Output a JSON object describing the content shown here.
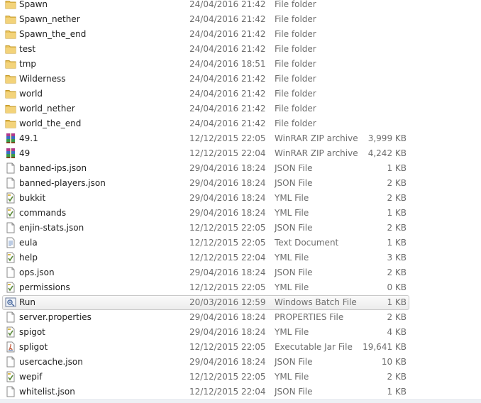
{
  "files": [
    {
      "name": "Spawn",
      "date": "24/04/2016 21:42",
      "type": "File folder",
      "size": "",
      "icon": "folder-icon"
    },
    {
      "name": "Spawn_nether",
      "date": "24/04/2016 21:42",
      "type": "File folder",
      "size": "",
      "icon": "folder-icon"
    },
    {
      "name": "Spawn_the_end",
      "date": "24/04/2016 21:42",
      "type": "File folder",
      "size": "",
      "icon": "folder-icon"
    },
    {
      "name": "test",
      "date": "24/04/2016 21:42",
      "type": "File folder",
      "size": "",
      "icon": "folder-icon"
    },
    {
      "name": "tmp",
      "date": "24/04/2016 18:51",
      "type": "File folder",
      "size": "",
      "icon": "folder-icon"
    },
    {
      "name": "Wilderness",
      "date": "24/04/2016 21:42",
      "type": "File folder",
      "size": "",
      "icon": "folder-icon"
    },
    {
      "name": "world",
      "date": "24/04/2016 21:42",
      "type": "File folder",
      "size": "",
      "icon": "folder-icon"
    },
    {
      "name": "world_nether",
      "date": "24/04/2016 21:42",
      "type": "File folder",
      "size": "",
      "icon": "folder-icon"
    },
    {
      "name": "world_the_end",
      "date": "24/04/2016 21:42",
      "type": "File folder",
      "size": "",
      "icon": "folder-icon"
    },
    {
      "name": "49.1",
      "date": "12/12/2015 22:05",
      "type": "WinRAR ZIP archive",
      "size": "3,999 KB",
      "icon": "winrar-archive-icon"
    },
    {
      "name": "49",
      "date": "12/12/2015 22:04",
      "type": "WinRAR ZIP archive",
      "size": "4,242 KB",
      "icon": "winrar-archive-icon"
    },
    {
      "name": "banned-ips.json",
      "date": "29/04/2016 18:24",
      "type": "JSON File",
      "size": "1 KB",
      "icon": "blank-file-icon"
    },
    {
      "name": "banned-players.json",
      "date": "29/04/2016 18:24",
      "type": "JSON File",
      "size": "2 KB",
      "icon": "blank-file-icon"
    },
    {
      "name": "bukkit",
      "date": "29/04/2016 18:24",
      "type": "YML File",
      "size": "2 KB",
      "icon": "yml-file-icon"
    },
    {
      "name": "commands",
      "date": "29/04/2016 18:24",
      "type": "YML File",
      "size": "1 KB",
      "icon": "yml-file-icon"
    },
    {
      "name": "enjin-stats.json",
      "date": "12/12/2015 22:05",
      "type": "JSON File",
      "size": "2 KB",
      "icon": "blank-file-icon"
    },
    {
      "name": "eula",
      "date": "12/12/2015 22:05",
      "type": "Text Document",
      "size": "1 KB",
      "icon": "text-document-icon"
    },
    {
      "name": "help",
      "date": "12/12/2015 22:04",
      "type": "YML File",
      "size": "3 KB",
      "icon": "yml-file-icon"
    },
    {
      "name": "ops.json",
      "date": "29/04/2016 18:24",
      "type": "JSON File",
      "size": "2 KB",
      "icon": "blank-file-icon"
    },
    {
      "name": "permissions",
      "date": "12/12/2015 22:05",
      "type": "YML File",
      "size": "0 KB",
      "icon": "yml-file-icon"
    },
    {
      "name": "Run",
      "date": "20/03/2016 12:59",
      "type": "Windows Batch File",
      "size": "1 KB",
      "icon": "batch-file-icon",
      "selected": true
    },
    {
      "name": "server.properties",
      "date": "29/04/2016 18:24",
      "type": "PROPERTIES File",
      "size": "2 KB",
      "icon": "blank-file-icon"
    },
    {
      "name": "spigot",
      "date": "29/04/2016 18:24",
      "type": "YML File",
      "size": "4 KB",
      "icon": "yml-file-icon"
    },
    {
      "name": "spligot",
      "date": "12/12/2015 22:05",
      "type": "Executable Jar File",
      "size": "19,641 KB",
      "icon": "jar-file-icon"
    },
    {
      "name": "usercache.json",
      "date": "29/04/2016 18:24",
      "type": "JSON File",
      "size": "10 KB",
      "icon": "blank-file-icon"
    },
    {
      "name": "wepif",
      "date": "12/12/2015 22:05",
      "type": "YML File",
      "size": "2 KB",
      "icon": "yml-file-icon"
    },
    {
      "name": "whitelist.json",
      "date": "12/12/2015 22:04",
      "type": "JSON File",
      "size": "1 KB",
      "icon": "blank-file-icon"
    }
  ],
  "colors": {
    "folder": "#e8c15a",
    "selection_border": "#c9c9c9",
    "meta_text": "#6d6d6d"
  }
}
